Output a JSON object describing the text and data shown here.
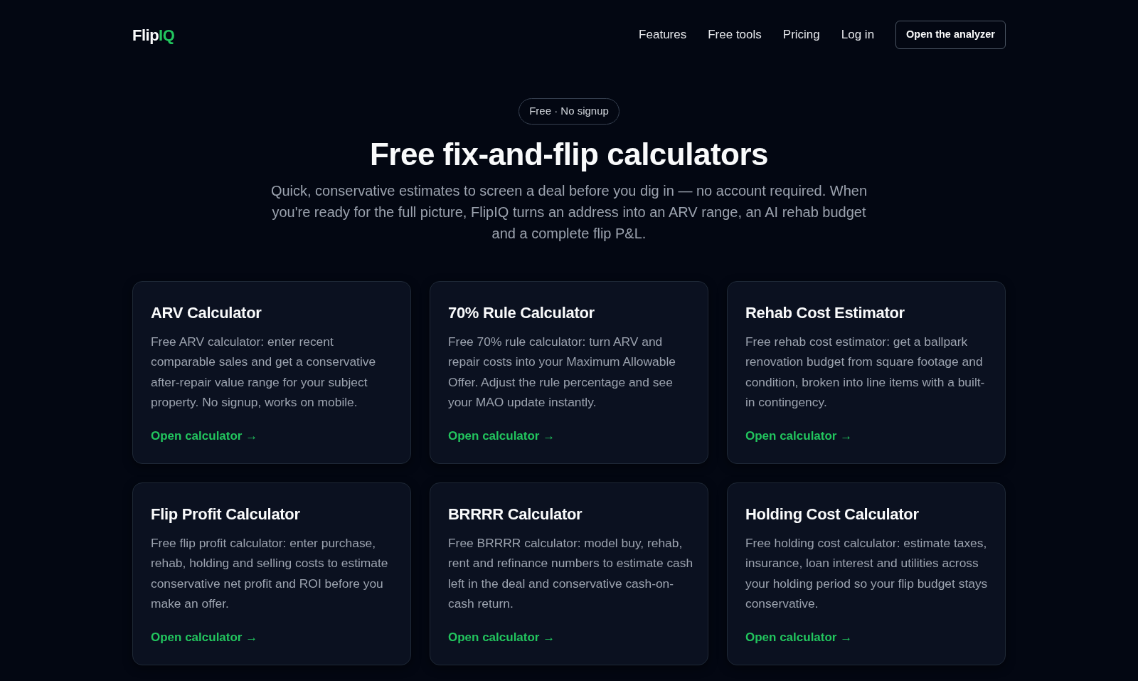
{
  "navbar": {
    "logo": {
      "text": "Flip",
      "accent": "IQ"
    },
    "links": [
      "Features",
      "Free tools",
      "Pricing",
      "Log in"
    ],
    "cta": "Open the analyzer"
  },
  "hero": {
    "badge": "Free · No signup",
    "title": "Free fix-and-flip calculators",
    "subtitle": "Quick, conservative estimates to screen a deal before you dig in — no account required. When you're ready for the full picture, FlipIQ turns an address into an ARV range, an AI rehab budget and a complete flip P&L."
  },
  "calculators": [
    {
      "title": "ARV Calculator",
      "description": "Free ARV calculator: enter recent comparable sales and get a conservative after-repair value range for your subject property. No signup, works on mobile.",
      "link": "Open calculator →"
    },
    {
      "title": "70% Rule Calculator",
      "description": "Free 70% rule calculator: turn ARV and repair costs into your Maximum Allowable Offer. Adjust the rule percentage and see your MAO update instantly.",
      "link": "Open calculator →"
    },
    {
      "title": "Rehab Cost Estimator",
      "description": "Free rehab cost estimator: get a ballpark renovation budget from square footage and condition, broken into line items with a built-in contingency.",
      "link": "Open calculator →"
    },
    {
      "title": "Flip Profit Calculator",
      "description": "Free flip profit calculator: enter purchase, rehab, holding and selling costs to estimate conservative net profit and ROI before you make an offer.",
      "link": "Open calculator →"
    },
    {
      "title": "BRRRR Calculator",
      "description": "Free BRRRR calculator: model buy, rehab, rent and refinance numbers to estimate cash left in the deal and conservative cash-on-cash return.",
      "link": "Open calculator →"
    },
    {
      "title": "Holding Cost Calculator",
      "description": "Free holding cost calculator: estimate taxes, insurance, loan interest and utilities across your holding period so your flip budget stays conservative.",
      "link": "Open calculator →"
    }
  ]
}
